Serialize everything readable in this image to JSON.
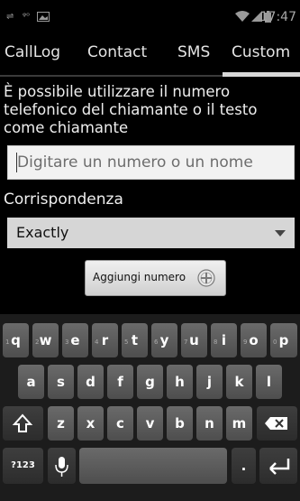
{
  "status_bar": {
    "time": "17:47",
    "icons": [
      "usb-icon",
      "voicemail-icon",
      "image-notification-icon",
      "wifi-icon",
      "signal-icon",
      "battery-icon"
    ]
  },
  "tabs": [
    {
      "label": "CallLog"
    },
    {
      "label": "Contact"
    },
    {
      "label": "SMS"
    },
    {
      "label": "Custom",
      "selected": true
    }
  ],
  "description": "È possibile utilizzare il numero telefonico del chiamante o il testo come chiamante",
  "number_input": {
    "placeholder": "Digitare un numero o un nome",
    "value": ""
  },
  "match": {
    "label": "Corrispondenza",
    "selected": "Exactly"
  },
  "add_button": {
    "label": "Aggiungi numero"
  },
  "keyboard": {
    "row1": [
      "q",
      "w",
      "e",
      "r",
      "t",
      "y",
      "u",
      "i",
      "o",
      "p"
    ],
    "row1_hints": [
      "1",
      "2",
      "3",
      "4",
      "5",
      "6",
      "7",
      "8",
      "9",
      "0"
    ],
    "row2": [
      "a",
      "s",
      "d",
      "f",
      "g",
      "h",
      "j",
      "k",
      "l"
    ],
    "row3": [
      "z",
      "x",
      "c",
      "v",
      "b",
      "n",
      "m"
    ],
    "symbols_label": "?123",
    "period_label": ".",
    "accent": "#ffffff"
  }
}
